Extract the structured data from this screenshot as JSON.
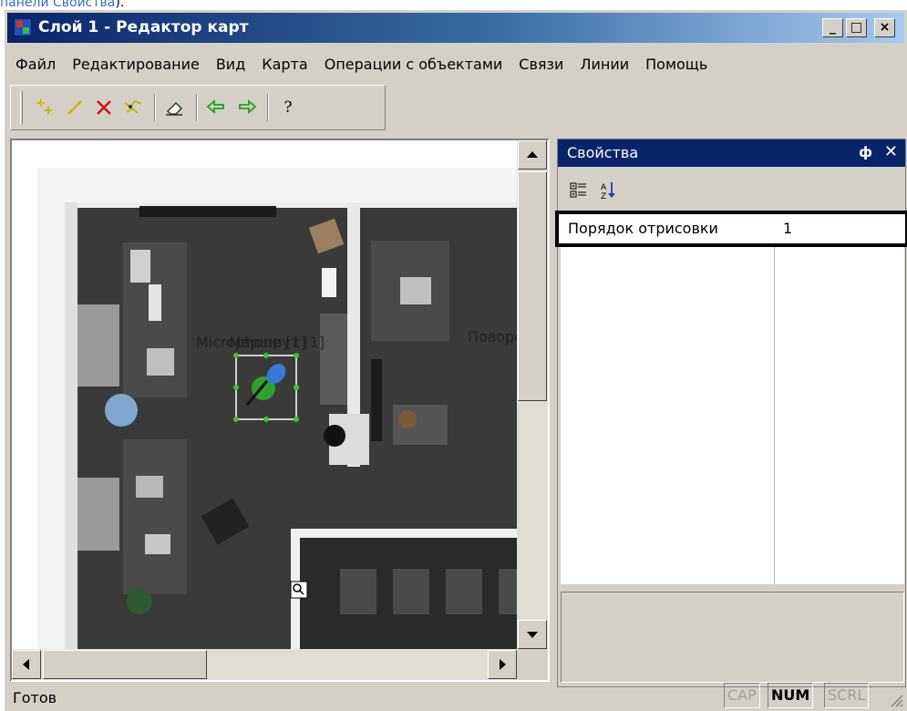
{
  "caption": {
    "link_text": "панели Свойства",
    "tail": ")."
  },
  "window": {
    "title": "Слой 1 - Редактор карт",
    "minimize": "_",
    "maximize": "□",
    "close": "×"
  },
  "menu": [
    "Файл",
    "Редактирование",
    "Вид",
    "Карта",
    "Операции с объектами",
    "Связи",
    "Линии",
    "Помощь"
  ],
  "toolbar": {
    "buttons": [
      {
        "icon": "add-point-icon"
      },
      {
        "icon": "draw-line-icon"
      },
      {
        "icon": "delete-icon"
      },
      {
        "icon": "node-edit-icon"
      },
      {
        "icon": "eraser-icon"
      },
      {
        "icon": "undo-icon"
      },
      {
        "icon": "redo-icon"
      },
      {
        "icon": "help-icon"
      }
    ],
    "help_label": "?"
  },
  "map": {
    "labels": [
      {
        "text": "Microphone [1]"
      },
      {
        "text": "Маршрут [1]"
      },
      {
        "text": "Поворот"
      }
    ],
    "colors": {
      "floor": "#3b3b3b",
      "wall": "#d8d8d8",
      "selection": "#3cc43c"
    }
  },
  "properties_panel": {
    "title": "Свойства",
    "pin": "ф",
    "close": "✕",
    "rows": [
      {
        "name": "Порядок отрисовки",
        "value": "1"
      }
    ]
  },
  "status": {
    "text": "Готов",
    "indicators": [
      {
        "label": "CAP",
        "active": false
      },
      {
        "label": "NUM",
        "active": true
      },
      {
        "label": "SCRL",
        "active": false
      }
    ]
  }
}
